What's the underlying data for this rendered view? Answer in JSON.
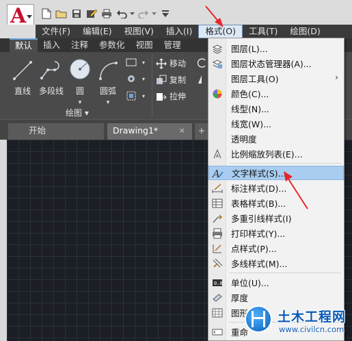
{
  "app": {
    "logo_letter": "A"
  },
  "menubar": {
    "items": [
      "文件(F)",
      "编辑(E)",
      "视图(V)",
      "插入(I)",
      "格式(O)",
      "工具(T)",
      "绘图(D)"
    ]
  },
  "ribbon": {
    "tabs": [
      "默认",
      "插入",
      "注释",
      "参数化",
      "视图",
      "管理"
    ],
    "draw_tools": [
      "直线",
      "多段线",
      "圆",
      "圆弧"
    ],
    "modify_tools": [
      "移动",
      "复制",
      "拉伸"
    ],
    "draw_panel_title": "绘图"
  },
  "doc_tabs": {
    "start": "开始",
    "drawing": "Drawing1*",
    "close": "×",
    "add": "+"
  },
  "format_menu": {
    "items": [
      {
        "label": "图层(L)...",
        "icon": "layer-icon"
      },
      {
        "label": "图层状态管理器(A)...",
        "icon": "layer-states-icon"
      },
      {
        "label": "图层工具(O)",
        "icon": "",
        "submenu": true
      },
      {
        "label": "颜色(C)...",
        "icon": "color-wheel-icon"
      },
      {
        "label": "线型(N)...",
        "icon": ""
      },
      {
        "label": "线宽(W)...",
        "icon": ""
      },
      {
        "label": "透明度",
        "icon": ""
      },
      {
        "label": "比例缩放列表(E)...",
        "icon": "scale-list-icon"
      },
      {
        "label": "文字样式(S)...",
        "icon": "text-style-icon",
        "highlighted": true
      },
      {
        "label": "标注样式(D)...",
        "icon": "dim-style-icon"
      },
      {
        "label": "表格样式(B)...",
        "icon": "table-style-icon"
      },
      {
        "label": "多重引线样式(I)",
        "icon": "mleader-style-icon"
      },
      {
        "label": "打印样式(Y)...",
        "icon": "plot-style-icon"
      },
      {
        "label": "点样式(P)...",
        "icon": "point-style-icon"
      },
      {
        "label": "多线样式(M)...",
        "icon": "mline-style-icon"
      },
      {
        "label": "单位(U)...",
        "icon": "units-icon"
      },
      {
        "label": "厚度",
        "icon": "thickness-icon"
      },
      {
        "label": "图形",
        "icon": "drawing-limits-icon"
      },
      {
        "label": "重命",
        "icon": "rename-icon"
      }
    ],
    "submenu_arrow": "›"
  },
  "watermark": {
    "title": "土木工程网",
    "url": "www.civilcn.com"
  },
  "colors": {
    "highlight": "#a9cdf0",
    "arrow": "#e8252c",
    "accent": "#0a58b5"
  }
}
